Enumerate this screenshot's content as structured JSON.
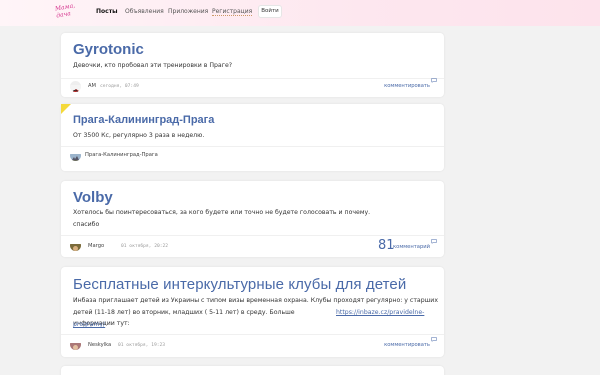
{
  "header": {
    "logo_text": "Мама, дача",
    "nav": [
      "Посты",
      "Объявления",
      "Приложения",
      "Регистрация"
    ],
    "login_label": "Войти"
  },
  "posts": [
    {
      "title": "Gyrotonic",
      "lines": [
        "Девочки, кто пробовал эти тренировки в Праге?"
      ],
      "author": "AM",
      "date": "сегодня, 07:49",
      "comment_label": "комментировать"
    },
    {
      "title": "Прага-Калининград-Прага",
      "lines": [
        "От 3500 Кс, регулярно 3 раза в неделю."
      ],
      "author": "Прага-Калининград-Прага"
    },
    {
      "title": "Volby",
      "lines": [
        "Хотелось бы поинтересоваться, за кого будете или точно не будете голосовать и почему.",
        "спасибо"
      ],
      "author": "Margo",
      "date": "01 октября, 20:22",
      "comment_count": "81",
      "comment_label": "комментарий"
    },
    {
      "title": "Бесплатные интеркультурные клубы для детей",
      "lines": [
        "Инбаза приглашает детей из Украины с типом визы временная охрана. Клубы проходят регулярно: у старших",
        "детей (11-18 лет) во вторник, младших ( 5-11 лет) в среду. Больше информации тут:",
        "https://inbaze.cz/pravidelne-",
        "programy/"
      ],
      "author": "Neskylka",
      "date": "01 октября, 19:23",
      "comment_label": "комментировать"
    }
  ],
  "colors": {
    "accent": "#4a6aa8",
    "flag": "#f4d93a",
    "header_bg": "#fde7ef"
  }
}
